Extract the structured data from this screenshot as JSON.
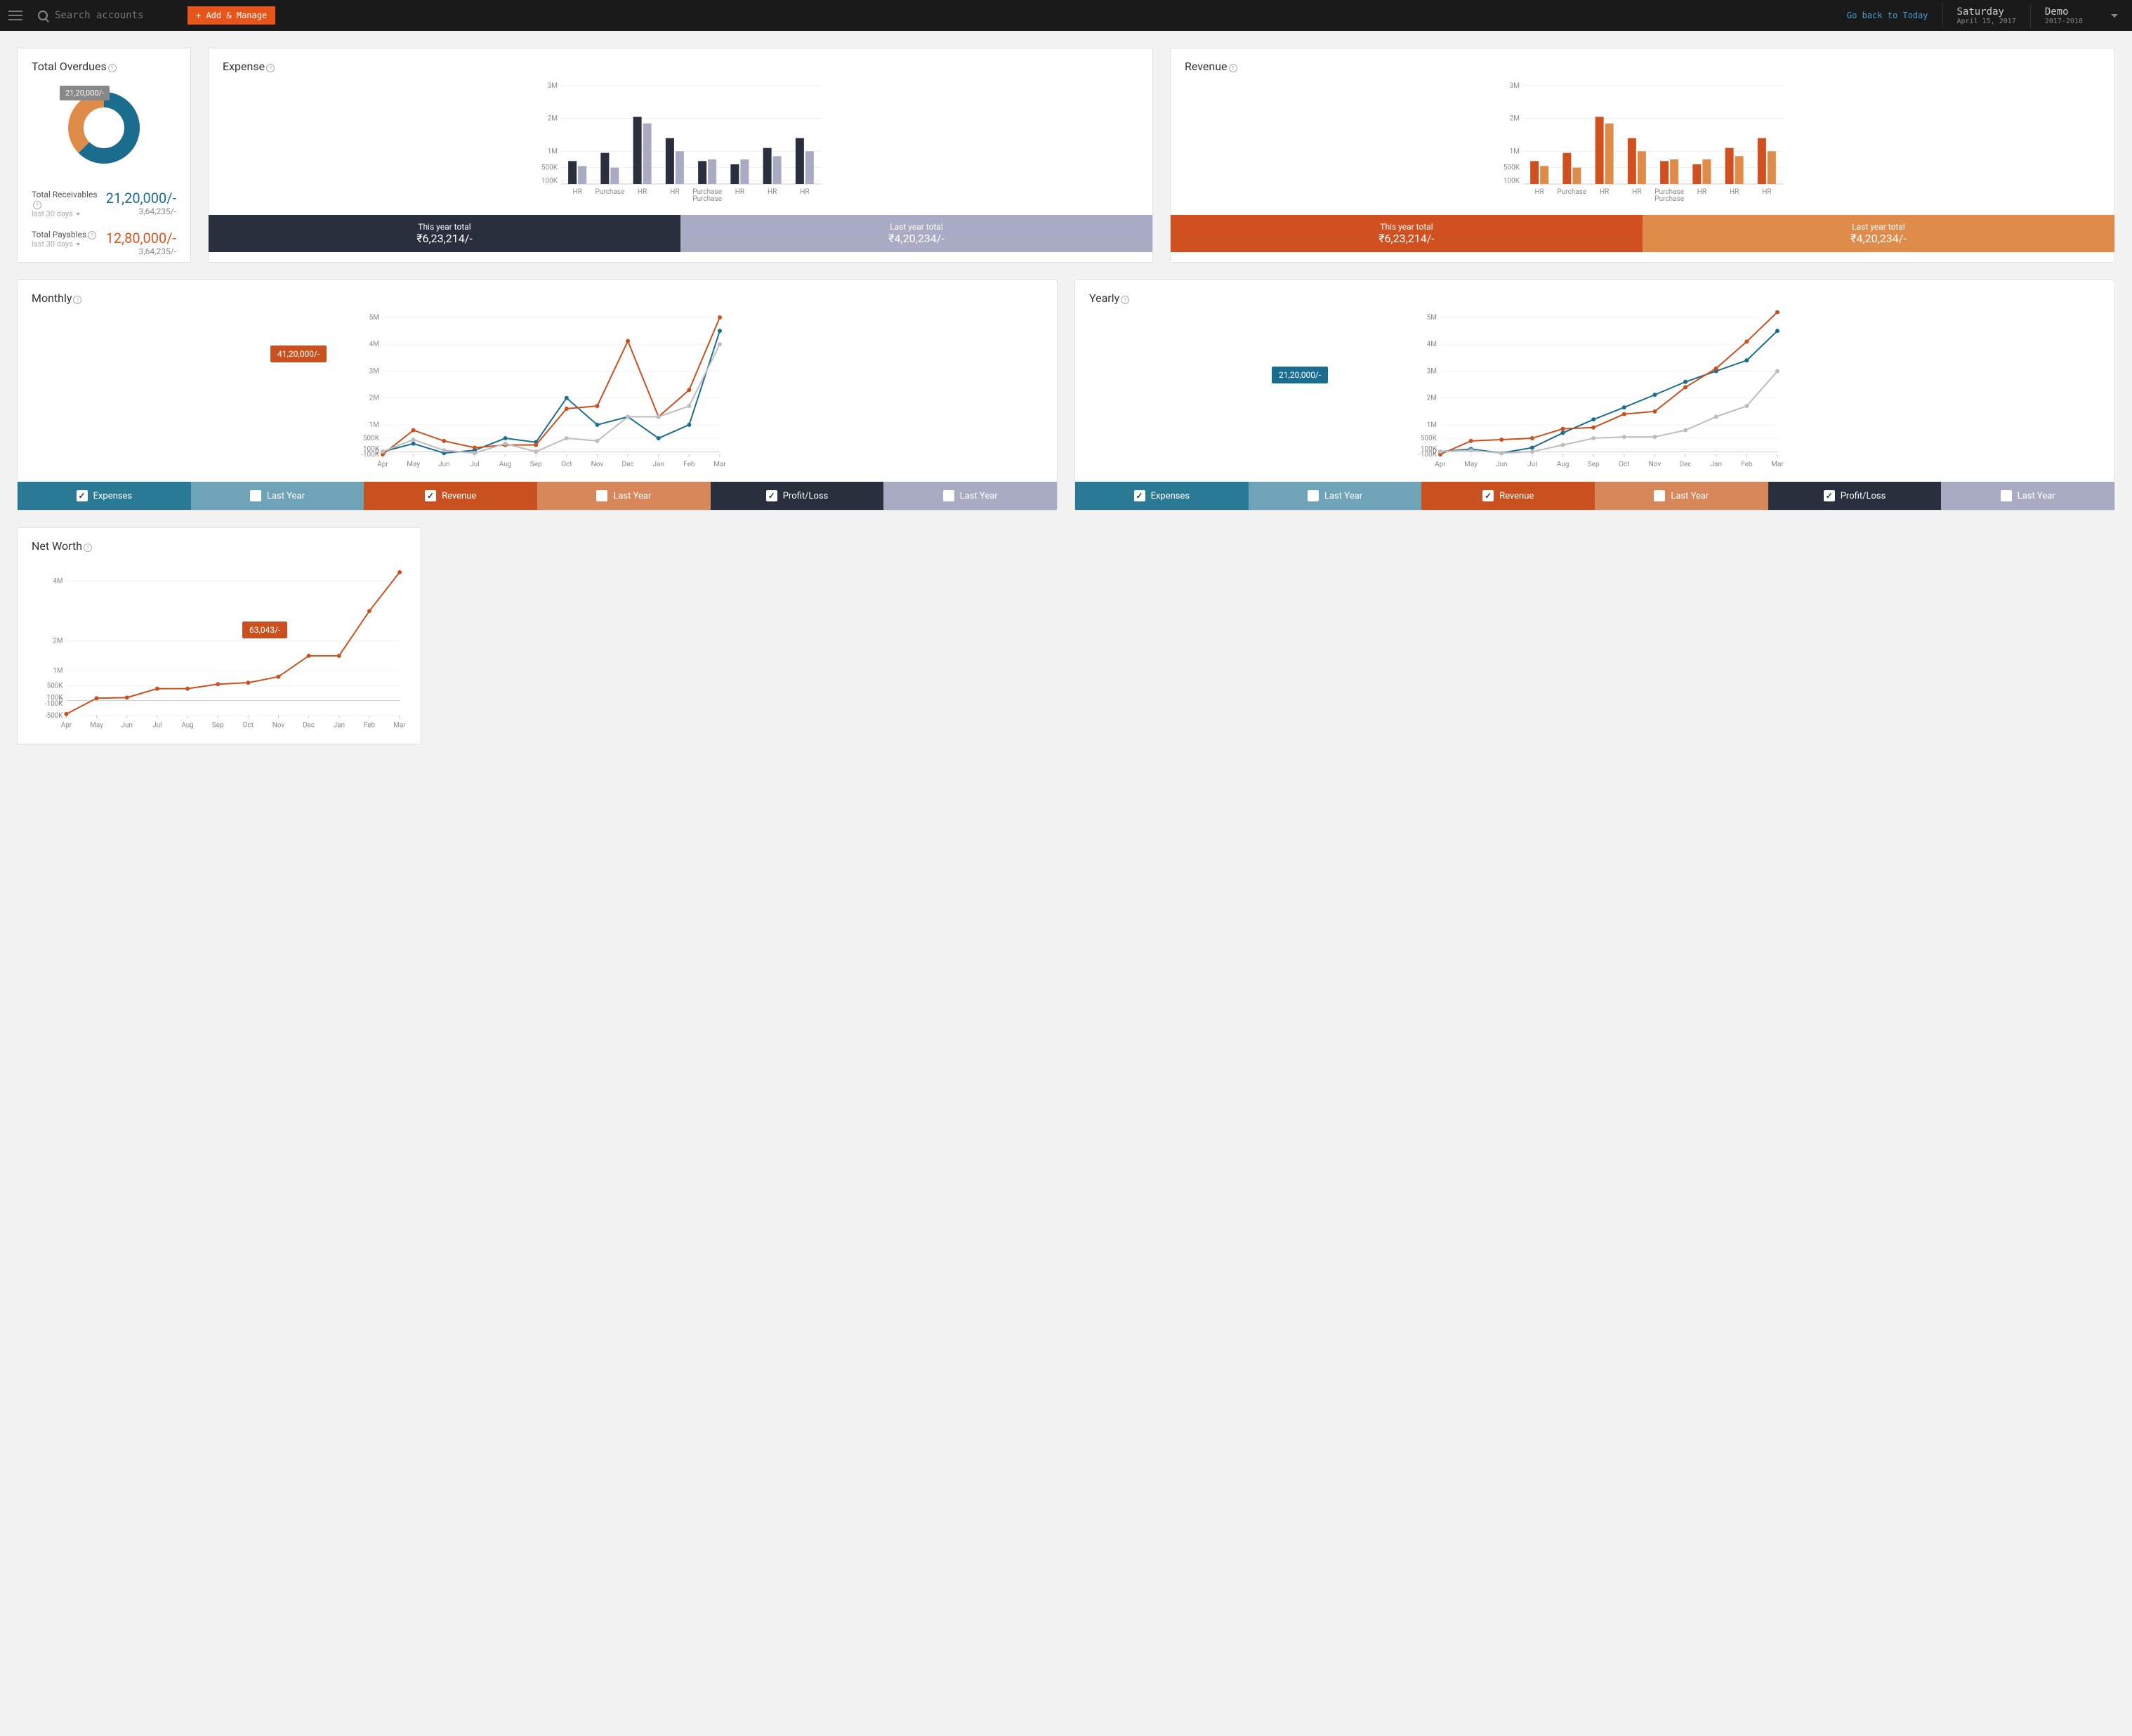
{
  "header": {
    "search_placeholder": "Search accounts",
    "add_btn": "+ Add & Manage",
    "go_back": "Go back to Today",
    "day": "Saturday",
    "date": "April 15, 2017",
    "demo": "Demo",
    "year": "2017-2018"
  },
  "overdues": {
    "title": "Total Overdues",
    "donut_label": "21,20,000/-",
    "recv_label": "Total Receivables",
    "recv_sub": "last 30 days",
    "recv_val": "21,20,000/-",
    "recv_sm": "3,64,235/-",
    "pay_label": "Total Payables",
    "pay_sub": "last 30 days",
    "pay_val": "12,80,000/-",
    "pay_sm": "3,64,235/-"
  },
  "expense": {
    "title": "Expense",
    "this_label": "This year total",
    "this_val": "₹6,23,214/-",
    "last_label": "Last year total",
    "last_val": "₹4,20,234/-"
  },
  "revenue": {
    "title": "Revenue",
    "this_label": "This year total",
    "this_val": "₹6,23,214/-",
    "last_label": "Last year total",
    "last_val": "₹4,20,234/-"
  },
  "monthly": {
    "title": "Monthly",
    "tooltip": "41,20,000/-"
  },
  "yearly": {
    "title": "Yearly",
    "tooltip": "21,20,000/-"
  },
  "networth": {
    "title": "Net Worth",
    "tooltip": "63,043/-"
  },
  "legend": {
    "exp": "Expenses",
    "exp_ly": "Last Year",
    "rev": "Revenue",
    "rev_ly": "Last Year",
    "pl": "Profit/Loss",
    "pl_ly": "Last Year"
  },
  "chart_data": [
    {
      "type": "pie",
      "title": "Total Overdues",
      "series": [
        {
          "name": "Receivables",
          "value": 2120000,
          "color": "#1a6d8f"
        },
        {
          "name": "Payables",
          "value": 1280000,
          "color": "#df8b49"
        }
      ]
    },
    {
      "type": "bar",
      "title": "Expense",
      "categories": [
        "HR",
        "Purchase",
        "HR",
        "HR",
        "Purchase Purchase",
        "HR",
        "HR",
        "HR"
      ],
      "series": [
        {
          "name": "This year",
          "color": "#2a2f3e",
          "values": [
            700000,
            950000,
            2050000,
            1400000,
            700000,
            600000,
            1100000,
            1400000
          ]
        },
        {
          "name": "Last year",
          "color": "#a9abc4",
          "values": [
            550000,
            500000,
            1850000,
            1000000,
            750000,
            750000,
            850000,
            1000000
          ]
        }
      ],
      "yticks": [
        "100K",
        "500K",
        "1M",
        "2M",
        "3M"
      ],
      "ylim": [
        0,
        3000000
      ]
    },
    {
      "type": "bar",
      "title": "Revenue",
      "categories": [
        "HR",
        "Purchase",
        "HR",
        "HR",
        "Purchase Purchase",
        "HR",
        "HR",
        "HR"
      ],
      "series": [
        {
          "name": "This year",
          "color": "#d0511f",
          "values": [
            700000,
            950000,
            2050000,
            1400000,
            700000,
            600000,
            1100000,
            1400000
          ]
        },
        {
          "name": "Last year",
          "color": "#df8b49",
          "values": [
            550000,
            500000,
            1850000,
            1000000,
            750000,
            750000,
            850000,
            1000000
          ]
        }
      ],
      "yticks": [
        "100K",
        "500K",
        "1M",
        "2M",
        "3M"
      ],
      "ylim": [
        0,
        3000000
      ]
    },
    {
      "type": "line",
      "title": "Monthly",
      "categories": [
        "Apr",
        "May",
        "Jun",
        "Jul",
        "Aug",
        "Sep",
        "Oct",
        "Nov",
        "Dec",
        "Jan",
        "Feb",
        "Mar"
      ],
      "series": [
        {
          "name": "Expenses",
          "color": "#1a6d8f",
          "values": [
            0,
            300000,
            -50000,
            50000,
            500000,
            350000,
            2000000,
            1000000,
            1300000,
            500000,
            1000000,
            4500000
          ]
        },
        {
          "name": "Revenue",
          "color": "#c9501f",
          "values": [
            -100000,
            800000,
            400000,
            150000,
            250000,
            250000,
            1600000,
            1700000,
            4120000,
            1300000,
            2300000,
            5000000
          ]
        },
        {
          "name": "Last Year",
          "color": "#bdbdbd",
          "values": [
            0,
            450000,
            50000,
            -50000,
            300000,
            0,
            500000,
            400000,
            1300000,
            1300000,
            1700000,
            4000000
          ]
        }
      ],
      "yticks": [
        "-100K",
        "0",
        "100K",
        "500K",
        "1M",
        "2M",
        "3M",
        "4M",
        "5M"
      ],
      "ylim": [
        -100000,
        5000000
      ]
    },
    {
      "type": "line",
      "title": "Yearly",
      "categories": [
        "Apr",
        "May",
        "Jun",
        "Jul",
        "Aug",
        "Sep",
        "Oct",
        "Nov",
        "Dec",
        "Jan",
        "Feb",
        "Mar"
      ],
      "series": [
        {
          "name": "Expenses",
          "color": "#1a6d8f",
          "values": [
            0,
            100000,
            -50000,
            150000,
            700000,
            1200000,
            1650000,
            2120000,
            2600000,
            3000000,
            3400000,
            4500000
          ]
        },
        {
          "name": "Revenue",
          "color": "#c9501f",
          "values": [
            -100000,
            400000,
            450000,
            500000,
            850000,
            900000,
            1400000,
            1500000,
            2400000,
            3100000,
            4100000,
            5200000
          ]
        },
        {
          "name": "Last Year",
          "color": "#bdbdbd",
          "values": [
            0,
            50000,
            -50000,
            0,
            250000,
            500000,
            550000,
            550000,
            800000,
            1300000,
            1700000,
            3000000
          ]
        }
      ],
      "yticks": [
        "-100K",
        "0",
        "100K",
        "500K",
        "1M",
        "2M",
        "3M",
        "4M",
        "5M"
      ],
      "ylim": [
        -100000,
        5000000
      ]
    },
    {
      "type": "line",
      "title": "Net Worth",
      "categories": [
        "Apr",
        "May",
        "Jun",
        "Jul",
        "Aug",
        "Sep",
        "Oct",
        "Nov",
        "Dec",
        "Jan",
        "Feb",
        "Mar"
      ],
      "series": [
        {
          "name": "Net Worth",
          "color": "#c9501f",
          "values": [
            -450000,
            80000,
            100000,
            400000,
            400000,
            550000,
            600000,
            800000,
            1500000,
            1500000,
            3000000,
            4300000
          ]
        }
      ],
      "yticks": [
        "-500K",
        "-100K",
        "0",
        "100K",
        "500K",
        "1M",
        "2M",
        "4M"
      ],
      "ylim": [
        -500000,
        4500000
      ]
    }
  ]
}
